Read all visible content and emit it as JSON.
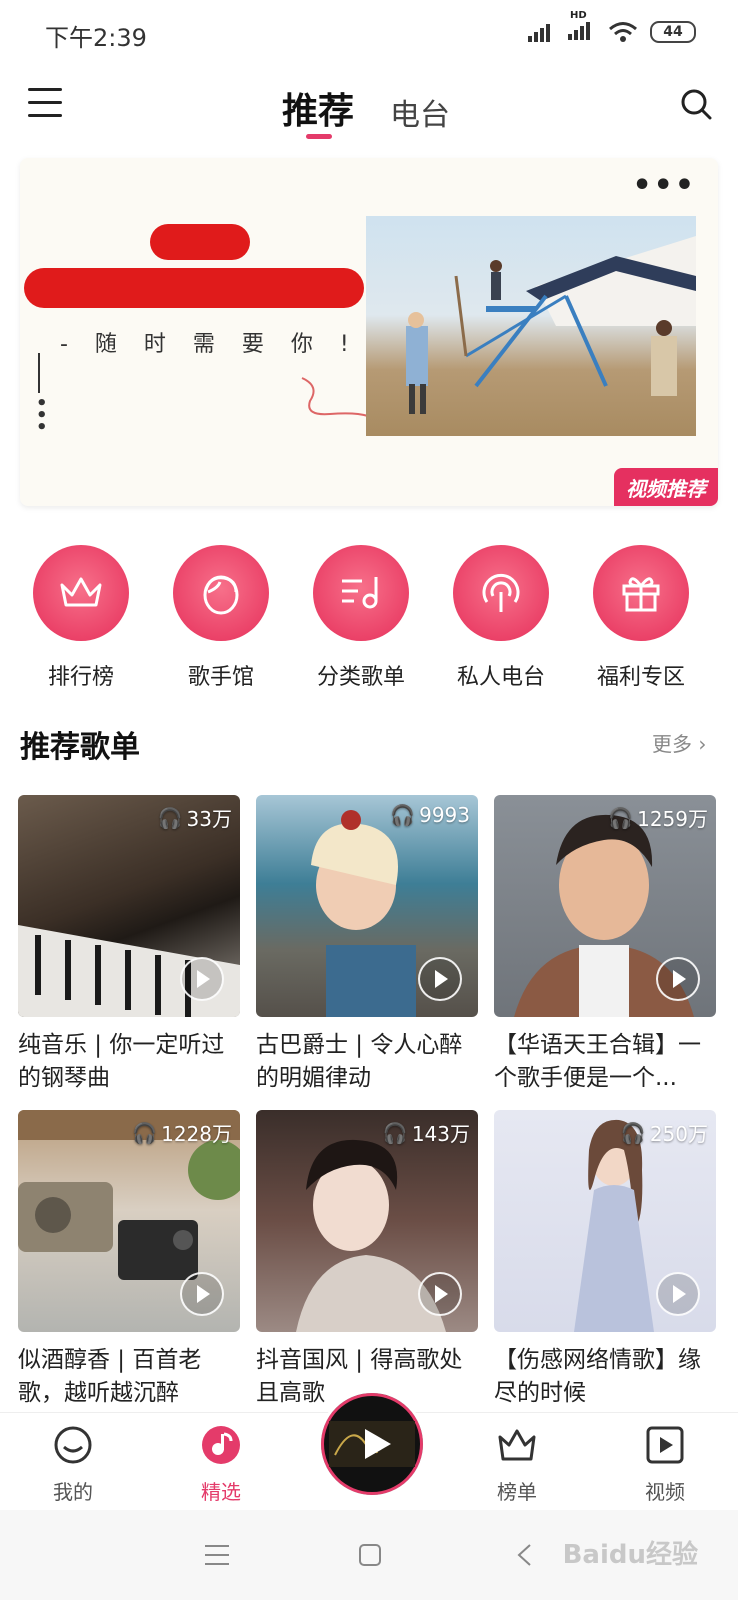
{
  "status_bar": {
    "time": "下午2:39",
    "battery": "44",
    "hd": "HD"
  },
  "top_nav": {
    "tabs": [
      {
        "label": "推荐",
        "active": true
      },
      {
        "label": "电台",
        "active": false
      }
    ]
  },
  "banner": {
    "slogan": "- 随 时 需 要 你 ! ! -",
    "tag": "视频推荐",
    "more": "•••"
  },
  "quick_menu": [
    {
      "label": "排行榜",
      "icon": "crown-icon"
    },
    {
      "label": "歌手馆",
      "icon": "singer-face-icon"
    },
    {
      "label": "分类歌单",
      "icon": "music-list-icon"
    },
    {
      "label": "私人电台",
      "icon": "radio-antenna-icon"
    },
    {
      "label": "福利专区",
      "icon": "gift-icon"
    }
  ],
  "section": {
    "title": "推荐歌单",
    "more": "更多 ›"
  },
  "playlists": [
    {
      "count": "33万",
      "title": "纯音乐 | 你一定听过的钢琴曲"
    },
    {
      "count": "9993",
      "title": "古巴爵士 | 令人心醉的明媚律动"
    },
    {
      "count": "1259万",
      "title": "【华语天王合辑】一个歌手便是一个..."
    },
    {
      "count": "1228万",
      "title": "似酒醇香 | 百首老歌，越听越沉醉"
    },
    {
      "count": "143万",
      "title": "抖音国风 | 得高歌处且高歌"
    },
    {
      "count": "250万",
      "title": "【伤感网络情歌】缘尽的时候"
    }
  ],
  "bottom_tabs": [
    {
      "label": "我的",
      "icon": "smile-icon",
      "active": false
    },
    {
      "label": "精选",
      "icon": "music-disc-icon",
      "active": true
    },
    {
      "label": "榜单",
      "icon": "crown-icon",
      "active": false
    },
    {
      "label": "视频",
      "icon": "video-play-icon",
      "active": false
    }
  ],
  "watermark": "Baidu经验",
  "colors": {
    "accent": "#e43b6a",
    "text": "#222222",
    "muted": "#888888"
  }
}
